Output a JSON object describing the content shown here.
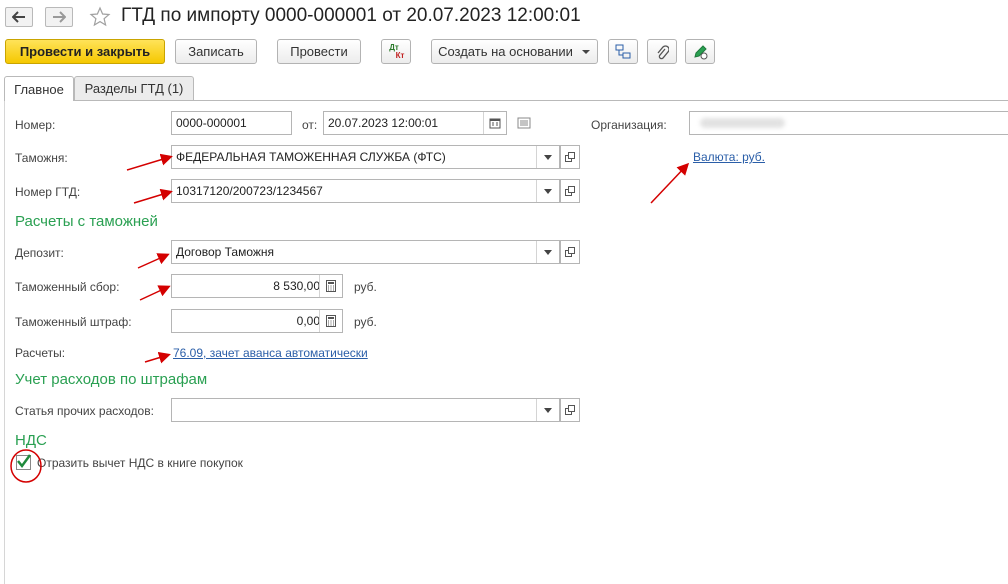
{
  "header": {
    "title": "ГТД по импорту 0000-000001 от 20.07.2023 12:00:01"
  },
  "toolbar": {
    "post_close": "Провести и закрыть",
    "save": "Записать",
    "post": "Провести",
    "dtkt_top": "Дт",
    "dtkt_bottom": "Кт",
    "create_based": "Создать на основании"
  },
  "tabs": [
    {
      "label": "Главное",
      "active": true
    },
    {
      "label": "Разделы ГТД (1)",
      "active": false
    }
  ],
  "form": {
    "number_label": "Номер:",
    "number_value": "0000-000001",
    "date_label": "от:",
    "date_value": "20.07.2023 12:00:01",
    "org_label": "Организация:",
    "customs_label": "Таможня:",
    "customs_value": "ФЕДЕРАЛЬНАЯ ТАМОЖЕННАЯ СЛУЖБА (ФТС)",
    "currency_link": "Валюта: руб.",
    "gtd_number_label": "Номер ГТД:",
    "gtd_number_value": "10317120/200723/1234567"
  },
  "settlements": {
    "title": "Расчеты с таможней",
    "deposit_label": "Депозит:",
    "deposit_value": "Договор Таможня",
    "fee_label": "Таможенный сбор:",
    "fee_value": "8 530,00",
    "fee_unit": "руб.",
    "fine_label": "Таможенный штраф:",
    "fine_value": "0,00",
    "fine_unit": "руб.",
    "calc_label": "Расчеты:",
    "calc_link": "76.09, зачет аванса автоматически"
  },
  "fines": {
    "title": "Учет расходов по штрафам",
    "expense_label": "Статья прочих расходов:",
    "expense_value": ""
  },
  "vat": {
    "title": "НДС",
    "deduction_label": "Отразить вычет НДС в книге покупок",
    "deduction_checked": true
  },
  "colors": {
    "section_green": "#2aa052",
    "link_blue": "#2a5ea8",
    "primary_yellow": "#f5c800",
    "annotation_red": "#d40000"
  }
}
